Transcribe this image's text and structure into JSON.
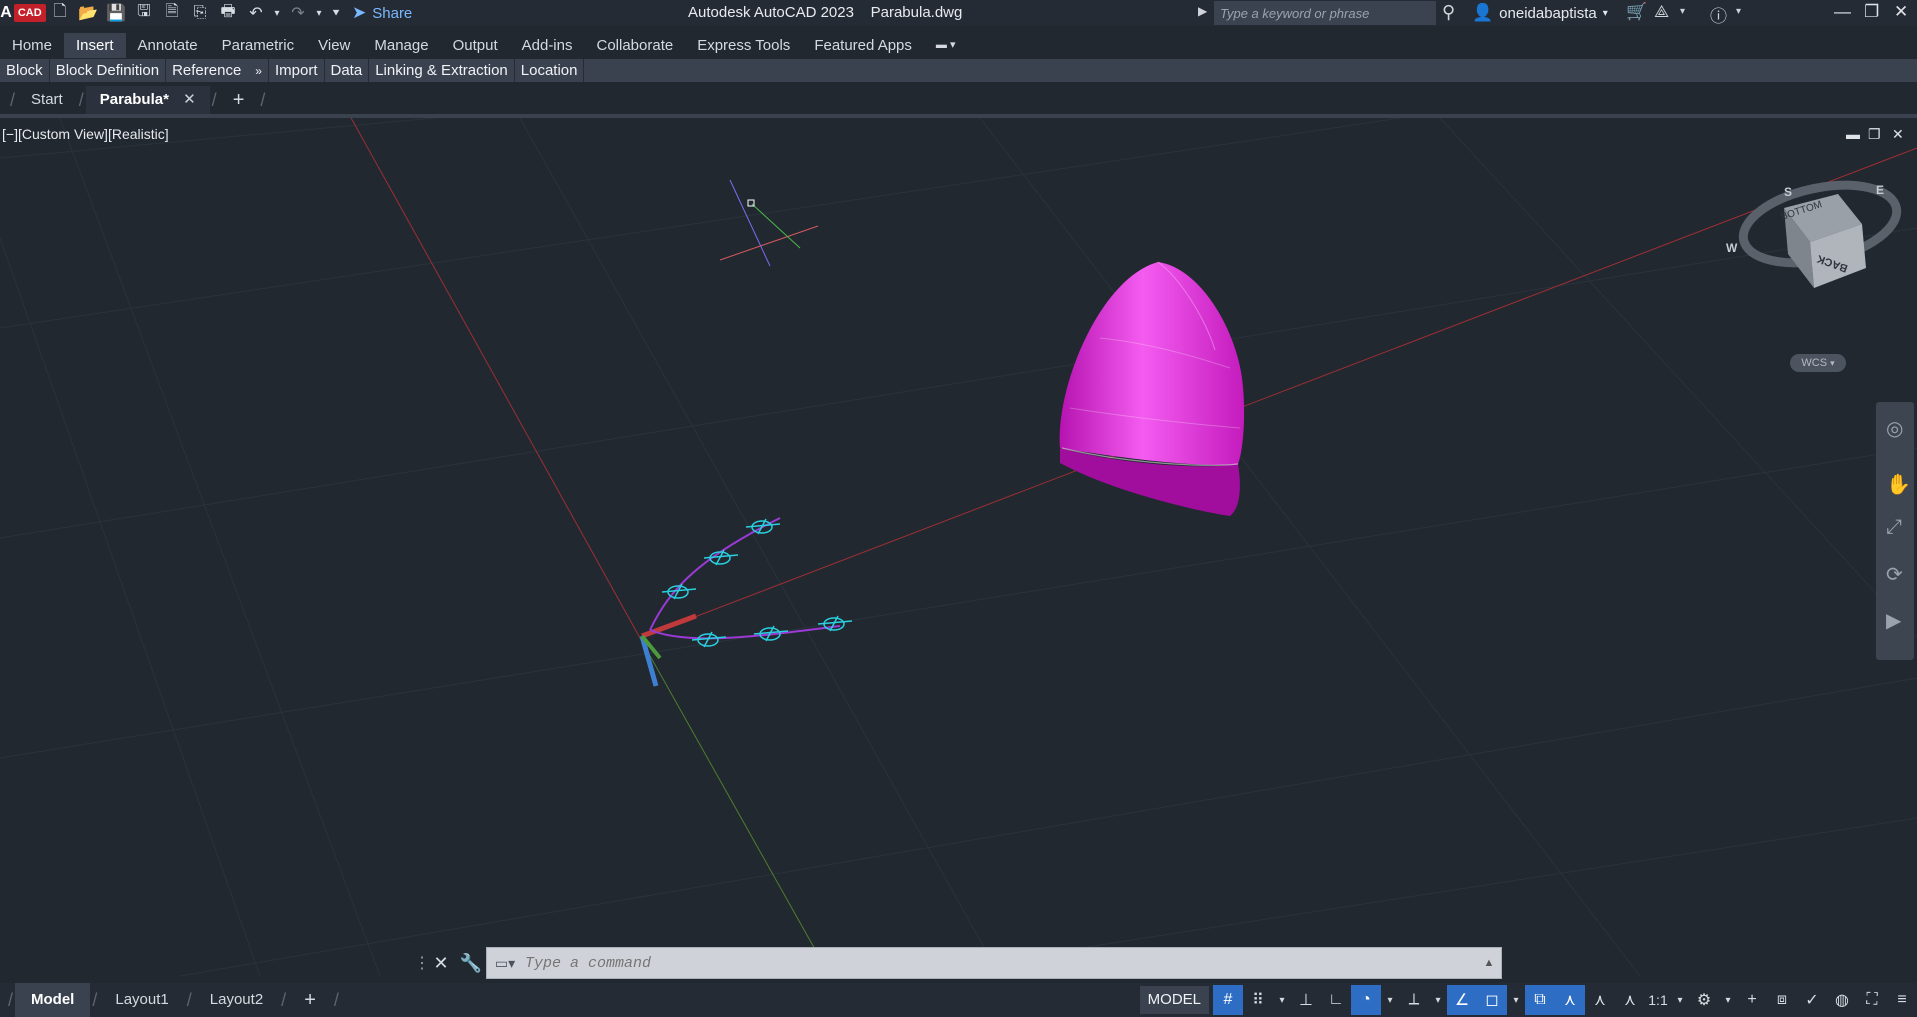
{
  "app": {
    "badge": "CAD",
    "title": "Autodesk AutoCAD 2023    Parabula.dwg",
    "share_label": "Share",
    "search_placeholder": "Type a keyword or phrase",
    "username": "oneidabaptista"
  },
  "quick_access": [
    "new-icon",
    "open-icon",
    "save-icon",
    "save-as-icon",
    "plot-preview-icon",
    "publish-icon",
    "print-icon",
    "undo-icon",
    "redo-icon",
    "customize-icon"
  ],
  "ribbon": {
    "tabs": [
      "Home",
      "Insert",
      "Annotate",
      "Parametric",
      "View",
      "Manage",
      "Output",
      "Add-ins",
      "Collaborate",
      "Express Tools",
      "Featured Apps"
    ],
    "active_tab": "Insert",
    "panels": [
      "Block",
      "Block Definition",
      "Reference",
      "Import",
      "Data",
      "Linking & Extraction",
      "Location"
    ],
    "reference_flyout": "»"
  },
  "doc_tabs": {
    "start": "Start",
    "active": "Parabula*",
    "close": "✕",
    "new": "+"
  },
  "viewport": {
    "label": "[−][Custom View][Realistic]",
    "wcs": "WCS",
    "viewcube": {
      "face_top": "BOTTOM",
      "face_front": "BACK",
      "compass": [
        "S",
        "E",
        "W"
      ]
    },
    "accent_colors": {
      "background": "#212830",
      "x_axis": "#c0393b",
      "y_axis": "#5a9a3a",
      "solid": "#e41fd9",
      "handles": "#2ad0e0"
    }
  },
  "command_line": {
    "placeholder": "Type a command"
  },
  "status_bar": {
    "layout_tabs": [
      "Model",
      "Layout1",
      "Layout2"
    ],
    "active_layout": "Model",
    "model_label": "MODEL",
    "scale": "1:1"
  }
}
